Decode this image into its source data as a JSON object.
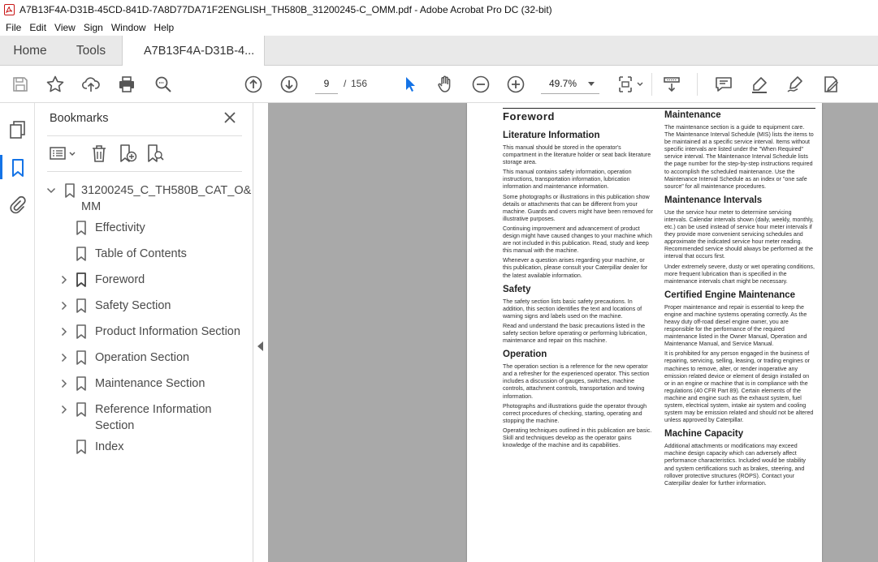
{
  "window": {
    "title": "A7B13F4A-D31B-45CD-841D-7A8D77DA71F2ENGLISH_TH580B_31200245-C_OMM.pdf - Adobe Acrobat Pro DC (32-bit)",
    "icon": "acrobat-icon",
    "accent": "#c81414"
  },
  "menu": [
    "File",
    "Edit",
    "View",
    "Sign",
    "Window",
    "Help"
  ],
  "tabs": {
    "home": "Home",
    "tools": "Tools",
    "doc": "A7B13F4A-D31B-4..."
  },
  "toolbar": {
    "page_current": "9",
    "page_sep": "/",
    "page_total": "156",
    "zoom": "49.7%",
    "accent": "#1473e6"
  },
  "bookmarks": {
    "title": "Bookmarks",
    "items": [
      {
        "label": "31200245_C_TH580B_CAT_O&",
        "label2": "MM",
        "expanded": true,
        "level": 0
      },
      {
        "label": "Effectivity",
        "level": 1,
        "children": false
      },
      {
        "label": "Table of Contents",
        "level": 1,
        "children": false
      },
      {
        "label": "Foreword",
        "level": 1,
        "children": true
      },
      {
        "label": "Safety Section",
        "level": 1,
        "children": true
      },
      {
        "label": "Product Information Section",
        "level": 1,
        "children": true
      },
      {
        "label": "Operation Section",
        "level": 1,
        "children": true
      },
      {
        "label": "Maintenance Section",
        "level": 1,
        "children": true
      },
      {
        "label": "Reference Information",
        "label2": "Section",
        "level": 1,
        "children": true
      },
      {
        "label": "Index",
        "level": 1,
        "children": false
      }
    ]
  },
  "document": {
    "left": {
      "title": "Foreword",
      "sections": [
        {
          "heading": "Literature Information",
          "paragraphs": [
            "This manual should be stored in the operator's compartment in the literature holder or seat back literature storage area.",
            "This manual contains safety information, operation instructions, transportation information, lubrication information and maintenance information.",
            "Some photographs or illustrations in this publication show details or attachments that can be different from your machine. Guards and covers might have been removed for illustrative purposes.",
            "Continuing improvement and advancement of product design might have caused changes to your machine which are not included in this publication. Read, study and keep this manual with the machine.",
            "Whenever a question arises regarding your machine, or this publication, please consult your Caterpillar dealer for the latest available information."
          ]
        },
        {
          "heading": "Safety",
          "paragraphs": [
            "The safety section lists basic safety precautions. In addition, this section identifies the text and locations of warning signs and labels used on the machine.",
            "Read and understand the basic precautions listed in the safety section before operating or performing lubrication, maintenance and repair on this machine."
          ]
        },
        {
          "heading": "Operation",
          "paragraphs": [
            "The operation section is a reference for the new operator and a refresher for the experienced operator. This section includes a discussion of gauges, switches, machine controls, attachment controls, transportation and towing information.",
            "Photographs and illustrations guide the operator through correct procedures of checking, starting, operating and stopping the machine.",
            "Operating techniques outlined in this publication are basic. Skill and techniques develop as the operator gains knowledge of the machine and its capabilities."
          ]
        }
      ]
    },
    "right": {
      "sections": [
        {
          "heading": "Maintenance",
          "paragraphs": [
            "The maintenance section is a guide to equipment care. The Maintenance Interval Schedule (MIS) lists the items to be maintained at a specific service interval. Items without specific intervals are listed under the \"When Required\" service interval. The Maintenance Interval Schedule lists the page number for the step-by-step instructions required to accomplish the scheduled maintenance. Use the Maintenance Interval Schedule as an index or \"one safe source\" for all maintenance procedures."
          ]
        },
        {
          "heading": "Maintenance Intervals",
          "paragraphs": [
            "Use the service hour meter to determine servicing intervals. Calendar intervals shown (daily, weekly, monthly, etc.) can be used instead of service hour meter intervals if they provide more convenient servicing schedules and approximate the indicated service hour meter reading. Recommended service should always be performed at the interval that occurs first.",
            "Under extremely severe, dusty or wet operating conditions, more frequent lubrication than is specified in the maintenance intervals chart might be necessary."
          ]
        },
        {
          "heading": "Certified Engine Maintenance",
          "paragraphs": [
            "Proper maintenance and repair is essential to keep the engine and machine systems operating correctly. As the heavy duty off-road diesel engine owner, you are responsible for the performance of the required maintenance listed in the Owner Manual, Operation and Maintenance Manual, and Service Manual.",
            "It is prohibited for any person engaged in the business of repairing, servicing, selling, leasing, or trading engines or machines to remove, alter, or render inoperative any emission related device or element of design installed on or in an engine or machine that is in compliance with the regulations (40 CFR Part 89). Certain elements of the machine and engine such as the exhaust system, fuel system, electrical system, intake air system and cooling system may be emission related and should not be altered unless approved by Caterpillar."
          ]
        },
        {
          "heading": "Machine Capacity",
          "paragraphs": [
            "Additional attachments or modifications may exceed machine design capacity which can adversely affect performance characteristics. Included would be stability and system certifications such as brakes, steering, and rollover protective structures (ROPS). Contact your Caterpillar dealer for further information."
          ]
        }
      ]
    }
  }
}
